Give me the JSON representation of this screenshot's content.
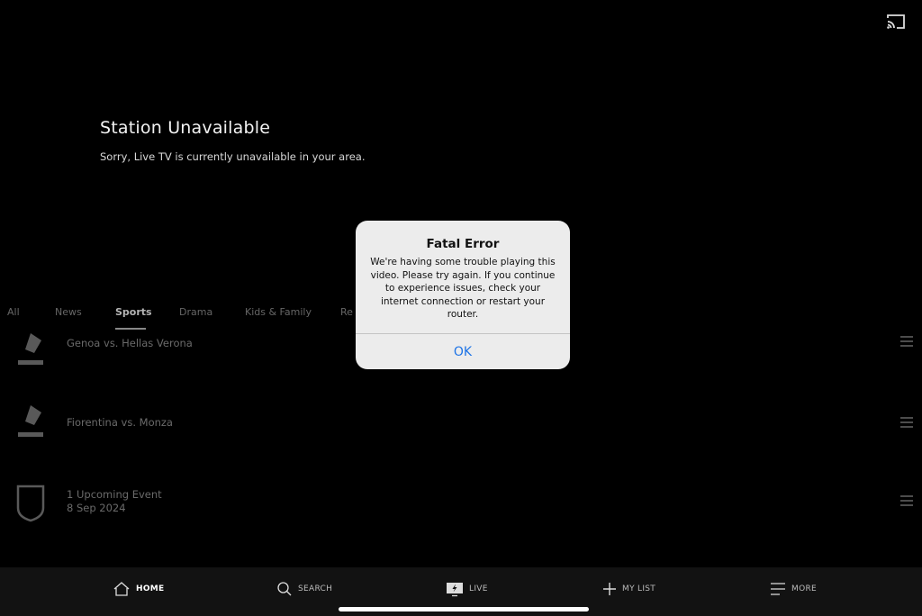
{
  "colors": {
    "background": "#000000",
    "alert_bg": "#ececec",
    "link_blue": "#1e74e6",
    "nav_bg": "#121212"
  },
  "header": {
    "cast_icon": "cast-icon"
  },
  "station": {
    "title": "Station Unavailable",
    "message": "Sorry, Live TV is currently unavailable in your area."
  },
  "categories": {
    "items": [
      "All",
      "News",
      "Sports",
      "Drama",
      "Kids & Family",
      "Re"
    ],
    "active": "Sports"
  },
  "events": [
    {
      "league_icon": "serie-a-icon",
      "title": "Genoa vs. Hellas Verona",
      "date": ""
    },
    {
      "league_icon": "serie-a-icon",
      "title": "Fiorentina vs. Monza",
      "date": ""
    },
    {
      "league_icon": "nfl-icon",
      "title": "1 Upcoming Event",
      "date": "8 Sep 2024"
    }
  ],
  "alert": {
    "title": "Fatal Error",
    "message": "We're having some trouble playing this video. Please try again. If you continue to experience issues, check your internet connection or restart your router.",
    "ok_label": "OK"
  },
  "nav": {
    "home": "HOME",
    "search": "SEARCH",
    "live": "LIVE",
    "my_list": "MY LIST",
    "more": "MORE",
    "active": "home"
  }
}
